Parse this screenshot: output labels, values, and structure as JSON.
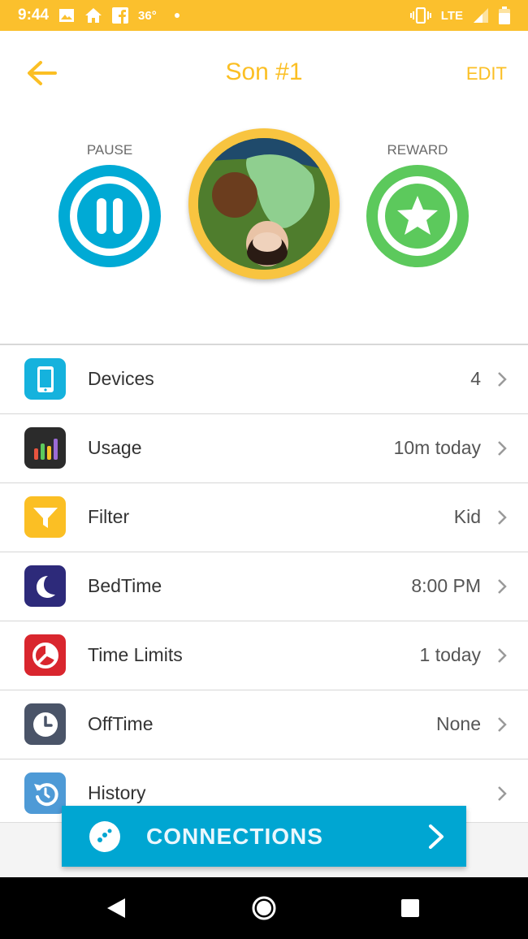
{
  "status_bar": {
    "time": "9:44",
    "temperature": "36°",
    "network": "LTE",
    "icons": [
      "image-icon",
      "home-icon",
      "facebook-icon",
      "dot-icon",
      "vibrate-icon",
      "signal-icon",
      "battery-icon"
    ]
  },
  "header": {
    "title": "Son #1",
    "edit_label": "EDIT",
    "accent_color": "#fbbf24"
  },
  "actions": {
    "pause_label": "PAUSE",
    "reward_label": "REWARD",
    "pause_color": "#00aad5",
    "reward_color": "#5cc95c"
  },
  "list": [
    {
      "label": "Devices",
      "value": "4",
      "icon": "phone-icon",
      "color": "#15b2dd"
    },
    {
      "label": "Usage",
      "value": "10m today",
      "icon": "bar-chart-icon",
      "color": "#2b2b2b"
    },
    {
      "label": "Filter",
      "value": "Kid",
      "icon": "funnel-icon",
      "color": "#fbbf24"
    },
    {
      "label": "BedTime",
      "value": "8:00 PM",
      "icon": "moon-icon",
      "color": "#2d2a7a"
    },
    {
      "label": "Time Limits",
      "value": "1 today",
      "icon": "timer-icon",
      "color": "#d9262e"
    },
    {
      "label": "OffTime",
      "value": "None",
      "icon": "clock-icon",
      "color": "#4a5468"
    },
    {
      "label": "History",
      "value": "",
      "icon": "history-icon",
      "color": "#4e9ad6"
    }
  ],
  "connections": {
    "label": "CONNECTIONS",
    "color": "#00a6d2"
  },
  "nav": {
    "icons": [
      "back-triangle-icon",
      "home-circle-icon",
      "recents-square-icon"
    ]
  }
}
